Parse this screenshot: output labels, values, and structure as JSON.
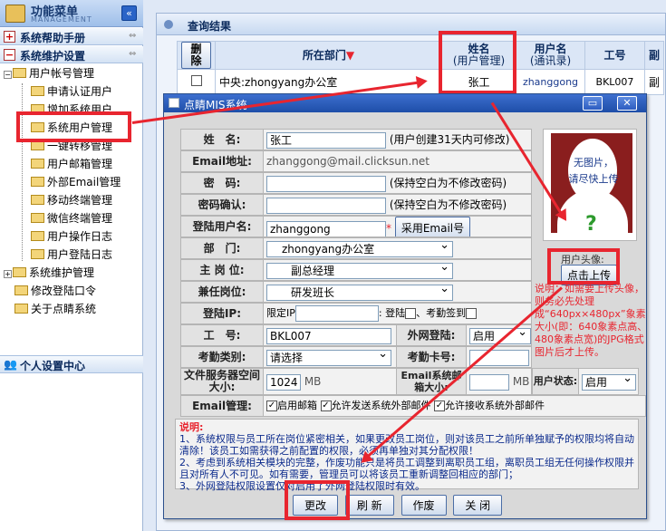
{
  "sidebar": {
    "title": "功能菜单",
    "subtitle": "MANAGEMENT",
    "collapse_icon": "«",
    "sections": [
      {
        "label": "系统帮助手册"
      },
      {
        "label": "系统维护设置"
      }
    ],
    "tree": [
      {
        "label": "用户帐号管理",
        "level": 1,
        "expand": "−"
      },
      {
        "label": "申请认证用户",
        "level": 2
      },
      {
        "label": "增加系统用户",
        "level": 2
      },
      {
        "label": "系统用户管理",
        "level": 2
      },
      {
        "label": "一键转移管理",
        "level": 2
      },
      {
        "label": "用户邮箱管理",
        "level": 2
      },
      {
        "label": "外部Email管理",
        "level": 2
      },
      {
        "label": "移动终端管理",
        "level": 2
      },
      {
        "label": "微信终端管理",
        "level": 2
      },
      {
        "label": "用户操作日志",
        "level": 2
      },
      {
        "label": "用户登陆日志",
        "level": 2
      },
      {
        "label": "系统维护管理",
        "level": 1,
        "expand": "+"
      },
      {
        "label": "修改登陆口令",
        "level": 1
      },
      {
        "label": "关于点睛系统",
        "level": 1
      }
    ],
    "user_center": "个人设置中心"
  },
  "results": {
    "title": "查询结果",
    "delete_label": "删除",
    "headers": {
      "dept": "所在部门",
      "sort_icon": "▼",
      "name": "姓名",
      "name_sub": "(用户管理)",
      "username": "用户名",
      "username_sub": "(通讯录)",
      "empno": "工号",
      "extra": "副"
    },
    "row": {
      "dept": "中央:zhongyang办公室",
      "name": "张工",
      "username": "zhanggong",
      "empno": "BKL007",
      "extra": "副"
    }
  },
  "dialog": {
    "title": "点睛MIS系统",
    "fields": {
      "name_label": "姓　名:",
      "name_value": "张工",
      "name_hint": "(用户创建31天内可修改)",
      "email_label": "Email地址:",
      "email_value": "zhanggong@mail.clicksun.net",
      "pwd_label": "密　码:",
      "pwd_hint": "(保持空白为不修改密码)",
      "pwd2_label": "密码确认:",
      "pwd2_hint": "(保持空白为不修改密码)",
      "login_label": "登陆用户名:",
      "login_value": "zhanggong",
      "login_star": "*",
      "use_email_btn": "采用Email号",
      "dept_label": "部　门:",
      "dept_value": "zhongyang办公室",
      "post_label": "主 岗 位:",
      "post_value": "副总经理",
      "post2_label": "兼任岗位:",
      "post2_value": "研发班长",
      "ip_label": "登陆IP:",
      "ip_placeholder": "限定IP",
      "ip_login": ": 登陆",
      "ip_attendance": "、考勤签到",
      "empno_label": "工　号:",
      "empno_value": "BKL007",
      "ext_login_label": "外网登陆:",
      "ext_login_value": "启用",
      "att_type_label": "考勤类别:",
      "att_type_value": "请选择",
      "att_card_label": "考勤卡号:",
      "fs_label": "文件服务器空间大小:",
      "fs_value": "1024",
      "fs_unit": "MB",
      "mail_size_label": "Email系统邮箱大小:",
      "mail_size_unit": "MB",
      "status_label": "用户状态:",
      "status_value": "启用",
      "email_mgmt_label": "Email管理:",
      "email_opt1": "启用邮箱",
      "email_opt2": "允许发送系统外部邮件",
      "email_opt3": "允许接收系统外部邮件"
    },
    "photo": {
      "no_photo_line1": "无图片，",
      "no_photo_line2": "请尽快上传",
      "question": "?",
      "avatar_label": "用户头像:",
      "upload_btn": "点击上传"
    },
    "side_note": "说明：如需要上传头像，则务必先处理成“640px×480px”象素大小(即：640象素点高、480象素点宽)的JPG格式图片后才上传。",
    "notes": {
      "heading": "说明:",
      "line1": "1、系统权限与员工所在岗位紧密相关，如果更改员工岗位，则对该员工之前所单独赋予的权限均将自动清除！该员工如需获得之前配置的权限，必须再单独对其分配权限！",
      "line2": "2、考虑到系统相关模块的完整，作废功能只是将员工调整到离职员工组，离职员工组无任何操作权限并且对所有人不可见。如有需要，管理员可以将该员工重新调整回相应的部门；",
      "line3": "3、外网登陆权限设置仅对启用了外网登陆权限时有效。"
    },
    "buttons": {
      "save": "更改",
      "refresh": "刷 新",
      "void": "作废",
      "close": "关 闭"
    }
  }
}
